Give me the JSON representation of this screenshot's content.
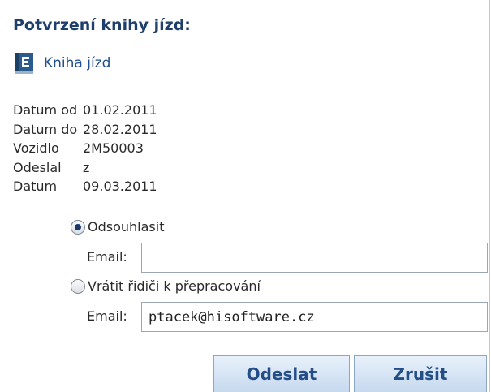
{
  "page": {
    "title": "Potvrzení knihy jízd:"
  },
  "book_link": {
    "label": "Kniha jízd",
    "icon": "book-icon"
  },
  "info": [
    {
      "label": "Datum od",
      "value": "01.02.2011"
    },
    {
      "label": "Datum do",
      "value": "28.02.2011"
    },
    {
      "label": "Vozidlo",
      "value": "2M50003"
    },
    {
      "label": "Odeslal",
      "value": "z"
    },
    {
      "label": "Datum",
      "value": "09.03.2011"
    }
  ],
  "approve": {
    "label": "Odsouhlasit",
    "checked": true,
    "email_label": "Email:",
    "email_value": ""
  },
  "return": {
    "label": "Vrátit řidiči k přepracování",
    "checked": false,
    "email_label": "Email:",
    "email_value": "ptacek@hisoftware.cz"
  },
  "buttons": {
    "send": "Odeslat",
    "cancel": "Zrušit"
  },
  "colors": {
    "title": "#1f3f6b",
    "link": "#1f4f8f",
    "button_text": "#244e86",
    "button_bg": "#d5e4f4"
  }
}
